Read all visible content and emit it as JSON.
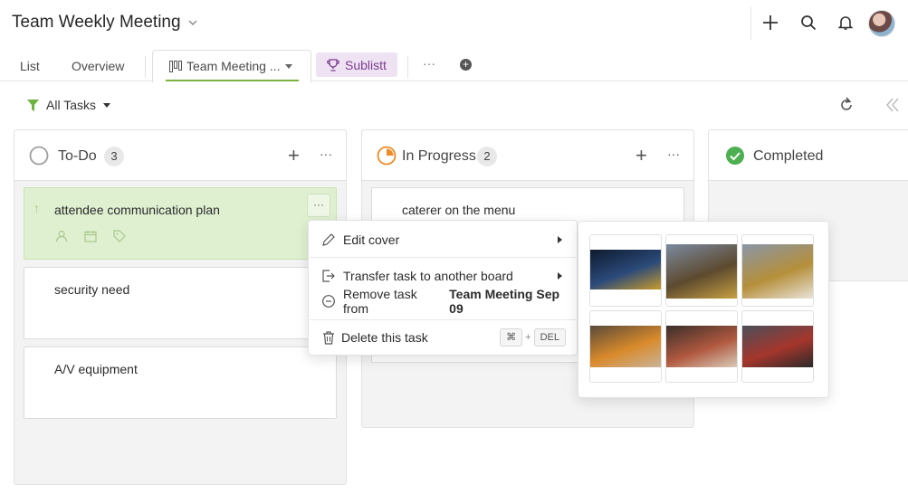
{
  "header": {
    "title": "Team Weekly Meeting",
    "actions": [
      "plus-icon",
      "search-icon",
      "bell-icon",
      "avatar"
    ]
  },
  "tabs": {
    "list": "List",
    "overview": "Overview",
    "board": "Team Meeting ...",
    "sublist": "Sublistt",
    "more": "···"
  },
  "toolbar": {
    "filter_label": "All Tasks"
  },
  "columns": [
    {
      "title": "To-Do",
      "count": "3",
      "status_color": "#9e9e9e"
    },
    {
      "title": "In Progress",
      "count": "2",
      "status_color": "#f08a24"
    },
    {
      "title": "Completed",
      "status_color": "#4caf50"
    }
  ],
  "todo_cards": [
    {
      "title": "attendee communication plan",
      "highlighted": true
    },
    {
      "title": "security need"
    },
    {
      "title": "A/V equipment"
    }
  ],
  "inprogress_cards": [
    {
      "title": "caterer on the menu"
    }
  ],
  "context_menu": {
    "edit_cover": "Edit cover",
    "transfer": "Transfer task to another board",
    "remove_prefix": "Remove task from",
    "remove_board": "Team Meeting Sep 09",
    "delete": "Delete this task",
    "shortcut_cmd": "⌘",
    "shortcut_plus": "+",
    "shortcut_del": "DEL"
  },
  "cover_images": [
    {
      "name": "pagoda-night",
      "colors": [
        "#0e1a2e",
        "#2b4a7a",
        "#c89b2a"
      ]
    },
    {
      "name": "golden-pavilion",
      "colors": [
        "#7b8aa0",
        "#5d4a2f",
        "#c7a042"
      ]
    },
    {
      "name": "golden-pavilion-ticket",
      "colors": [
        "#8a96a8",
        "#b58f3a",
        "#e9e3d8"
      ]
    },
    {
      "name": "fries",
      "colors": [
        "#5a4a3a",
        "#d98a2b",
        "#c9b39a"
      ]
    },
    {
      "name": "dinner-table",
      "colors": [
        "#3a2f2a",
        "#b0583f",
        "#d8cbb8"
      ]
    },
    {
      "name": "red-shrine",
      "colors": [
        "#4a4f5a",
        "#a5362c",
        "#2a2a2a"
      ]
    }
  ]
}
